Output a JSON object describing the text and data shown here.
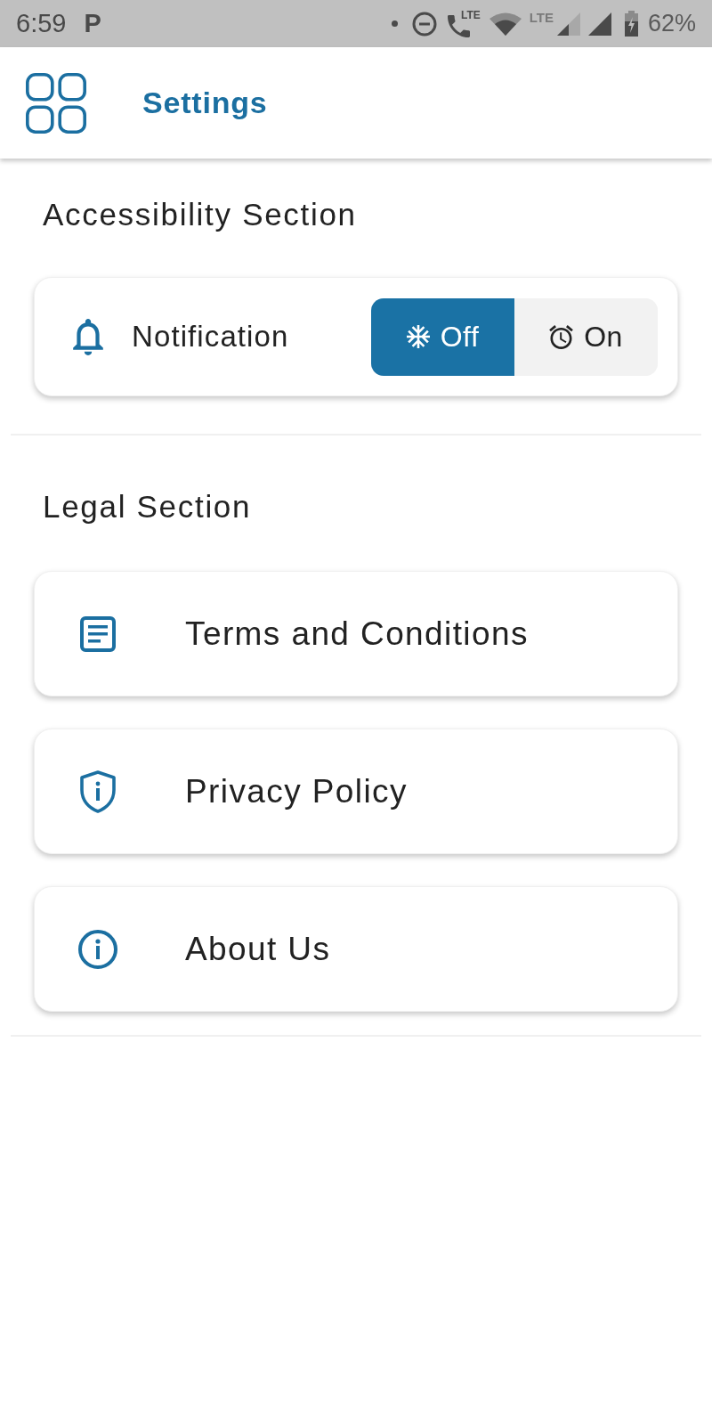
{
  "status_bar": {
    "time": "6:59",
    "app_icon": "P",
    "call_label": "LTE",
    "network_label": "LTE",
    "battery": "62%"
  },
  "app_bar": {
    "title": "Settings"
  },
  "sections": [
    {
      "title": "Accessibility Section",
      "items": [
        {
          "kind": "toggle",
          "label": "Notification",
          "options": [
            {
              "label": "Off",
              "selected": true
            },
            {
              "label": "On",
              "selected": false
            }
          ]
        }
      ]
    },
    {
      "title": "Legal Section",
      "items": [
        {
          "kind": "link",
          "label": "Terms and Conditions"
        },
        {
          "kind": "link",
          "label": "Privacy Policy"
        },
        {
          "kind": "link",
          "label": "About Us"
        }
      ]
    }
  ]
}
